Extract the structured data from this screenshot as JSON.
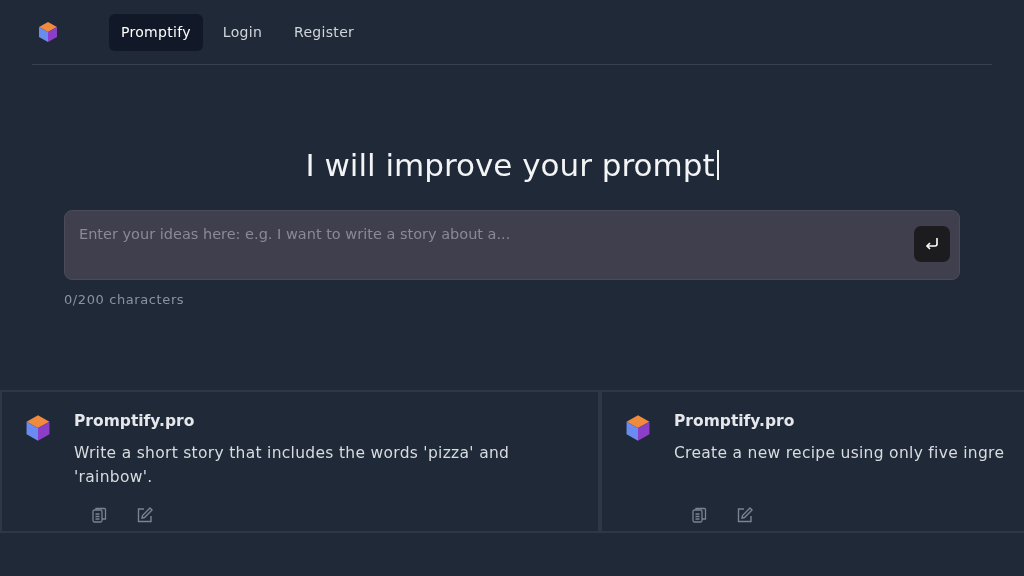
{
  "nav": {
    "links": [
      {
        "label": "Promptify",
        "selected": true
      },
      {
        "label": "Login",
        "selected": false
      },
      {
        "label": "Register",
        "selected": false
      }
    ]
  },
  "hero": {
    "title": "I will improve your prompt",
    "cursor": true
  },
  "prompt_input": {
    "placeholder": "Enter your ideas here: e.g. I want to write a story about a...",
    "counter": "0/200 characters"
  },
  "cards": [
    {
      "author": "Promptify.pro",
      "text": "Write a short story that includes the words 'pizza' and 'rainbow'."
    },
    {
      "author": "Promptify.pro",
      "text": "Create a new recipe using only five ingre"
    }
  ]
}
